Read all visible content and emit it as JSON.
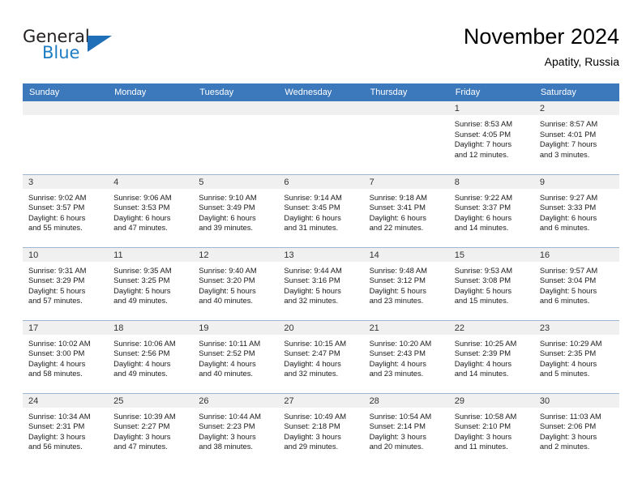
{
  "brand": {
    "name_part1": "General",
    "name_part2": "Blue",
    "accent_color": "#1f7dc4",
    "logo_icon": "triangle-icon"
  },
  "header": {
    "title": "November 2024",
    "subtitle": "Apatity, Russia"
  },
  "theme": {
    "header_bg": "#3c78bc",
    "header_text": "#ffffff",
    "daynum_band_bg": "#f0f0f0",
    "row_divider": "#9db8d6"
  },
  "weekdays": [
    "Sunday",
    "Monday",
    "Tuesday",
    "Wednesday",
    "Thursday",
    "Friday",
    "Saturday"
  ],
  "weeks": [
    [
      {
        "day": "",
        "lines": []
      },
      {
        "day": "",
        "lines": []
      },
      {
        "day": "",
        "lines": []
      },
      {
        "day": "",
        "lines": []
      },
      {
        "day": "",
        "lines": []
      },
      {
        "day": "1",
        "lines": [
          "Sunrise: 8:53 AM",
          "Sunset: 4:05 PM",
          "Daylight: 7 hours",
          "and 12 minutes."
        ]
      },
      {
        "day": "2",
        "lines": [
          "Sunrise: 8:57 AM",
          "Sunset: 4:01 PM",
          "Daylight: 7 hours",
          "and 3 minutes."
        ]
      }
    ],
    [
      {
        "day": "3",
        "lines": [
          "Sunrise: 9:02 AM",
          "Sunset: 3:57 PM",
          "Daylight: 6 hours",
          "and 55 minutes."
        ]
      },
      {
        "day": "4",
        "lines": [
          "Sunrise: 9:06 AM",
          "Sunset: 3:53 PM",
          "Daylight: 6 hours",
          "and 47 minutes."
        ]
      },
      {
        "day": "5",
        "lines": [
          "Sunrise: 9:10 AM",
          "Sunset: 3:49 PM",
          "Daylight: 6 hours",
          "and 39 minutes."
        ]
      },
      {
        "day": "6",
        "lines": [
          "Sunrise: 9:14 AM",
          "Sunset: 3:45 PM",
          "Daylight: 6 hours",
          "and 31 minutes."
        ]
      },
      {
        "day": "7",
        "lines": [
          "Sunrise: 9:18 AM",
          "Sunset: 3:41 PM",
          "Daylight: 6 hours",
          "and 22 minutes."
        ]
      },
      {
        "day": "8",
        "lines": [
          "Sunrise: 9:22 AM",
          "Sunset: 3:37 PM",
          "Daylight: 6 hours",
          "and 14 minutes."
        ]
      },
      {
        "day": "9",
        "lines": [
          "Sunrise: 9:27 AM",
          "Sunset: 3:33 PM",
          "Daylight: 6 hours",
          "and 6 minutes."
        ]
      }
    ],
    [
      {
        "day": "10",
        "lines": [
          "Sunrise: 9:31 AM",
          "Sunset: 3:29 PM",
          "Daylight: 5 hours",
          "and 57 minutes."
        ]
      },
      {
        "day": "11",
        "lines": [
          "Sunrise: 9:35 AM",
          "Sunset: 3:25 PM",
          "Daylight: 5 hours",
          "and 49 minutes."
        ]
      },
      {
        "day": "12",
        "lines": [
          "Sunrise: 9:40 AM",
          "Sunset: 3:20 PM",
          "Daylight: 5 hours",
          "and 40 minutes."
        ]
      },
      {
        "day": "13",
        "lines": [
          "Sunrise: 9:44 AM",
          "Sunset: 3:16 PM",
          "Daylight: 5 hours",
          "and 32 minutes."
        ]
      },
      {
        "day": "14",
        "lines": [
          "Sunrise: 9:48 AM",
          "Sunset: 3:12 PM",
          "Daylight: 5 hours",
          "and 23 minutes."
        ]
      },
      {
        "day": "15",
        "lines": [
          "Sunrise: 9:53 AM",
          "Sunset: 3:08 PM",
          "Daylight: 5 hours",
          "and 15 minutes."
        ]
      },
      {
        "day": "16",
        "lines": [
          "Sunrise: 9:57 AM",
          "Sunset: 3:04 PM",
          "Daylight: 5 hours",
          "and 6 minutes."
        ]
      }
    ],
    [
      {
        "day": "17",
        "lines": [
          "Sunrise: 10:02 AM",
          "Sunset: 3:00 PM",
          "Daylight: 4 hours",
          "and 58 minutes."
        ]
      },
      {
        "day": "18",
        "lines": [
          "Sunrise: 10:06 AM",
          "Sunset: 2:56 PM",
          "Daylight: 4 hours",
          "and 49 minutes."
        ]
      },
      {
        "day": "19",
        "lines": [
          "Sunrise: 10:11 AM",
          "Sunset: 2:52 PM",
          "Daylight: 4 hours",
          "and 40 minutes."
        ]
      },
      {
        "day": "20",
        "lines": [
          "Sunrise: 10:15 AM",
          "Sunset: 2:47 PM",
          "Daylight: 4 hours",
          "and 32 minutes."
        ]
      },
      {
        "day": "21",
        "lines": [
          "Sunrise: 10:20 AM",
          "Sunset: 2:43 PM",
          "Daylight: 4 hours",
          "and 23 minutes."
        ]
      },
      {
        "day": "22",
        "lines": [
          "Sunrise: 10:25 AM",
          "Sunset: 2:39 PM",
          "Daylight: 4 hours",
          "and 14 minutes."
        ]
      },
      {
        "day": "23",
        "lines": [
          "Sunrise: 10:29 AM",
          "Sunset: 2:35 PM",
          "Daylight: 4 hours",
          "and 5 minutes."
        ]
      }
    ],
    [
      {
        "day": "24",
        "lines": [
          "Sunrise: 10:34 AM",
          "Sunset: 2:31 PM",
          "Daylight: 3 hours",
          "and 56 minutes."
        ]
      },
      {
        "day": "25",
        "lines": [
          "Sunrise: 10:39 AM",
          "Sunset: 2:27 PM",
          "Daylight: 3 hours",
          "and 47 minutes."
        ]
      },
      {
        "day": "26",
        "lines": [
          "Sunrise: 10:44 AM",
          "Sunset: 2:23 PM",
          "Daylight: 3 hours",
          "and 38 minutes."
        ]
      },
      {
        "day": "27",
        "lines": [
          "Sunrise: 10:49 AM",
          "Sunset: 2:18 PM",
          "Daylight: 3 hours",
          "and 29 minutes."
        ]
      },
      {
        "day": "28",
        "lines": [
          "Sunrise: 10:54 AM",
          "Sunset: 2:14 PM",
          "Daylight: 3 hours",
          "and 20 minutes."
        ]
      },
      {
        "day": "29",
        "lines": [
          "Sunrise: 10:58 AM",
          "Sunset: 2:10 PM",
          "Daylight: 3 hours",
          "and 11 minutes."
        ]
      },
      {
        "day": "30",
        "lines": [
          "Sunrise: 11:03 AM",
          "Sunset: 2:06 PM",
          "Daylight: 3 hours",
          "and 2 minutes."
        ]
      }
    ]
  ]
}
